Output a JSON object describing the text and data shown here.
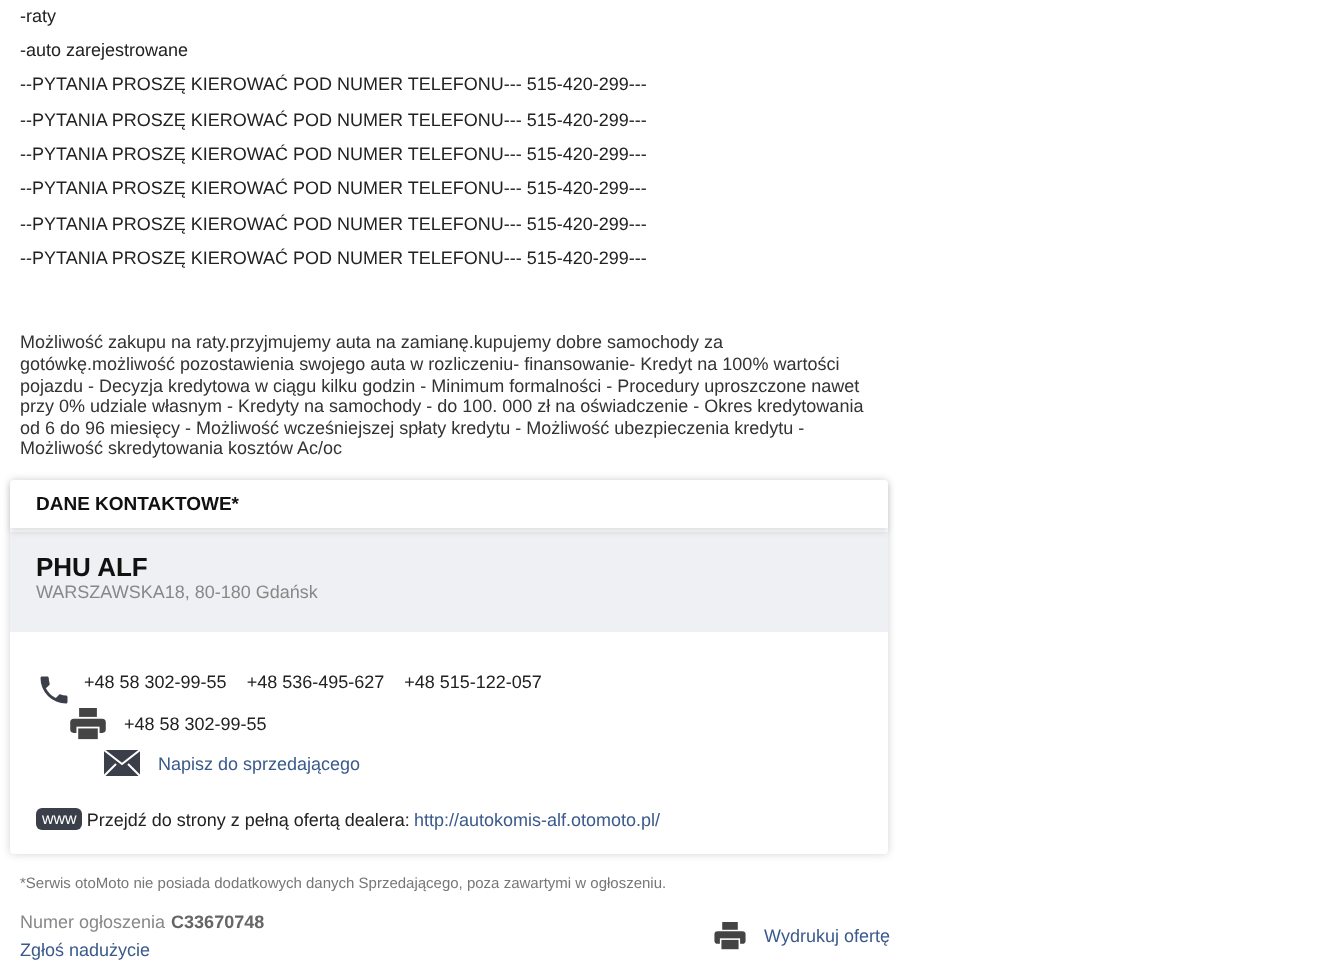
{
  "description_lines": [
    "-raty",
    "-auto zarejestrowane",
    "--PYTANIA PROSZĘ KIEROWAĆ POD NUMER TELEFONU--- 515-420-299---",
    "--PYTANIA PROSZĘ KIEROWAĆ POD NUMER TELEFONU--- 515-420-299---",
    "--PYTANIA PROSZĘ KIEROWAĆ POD NUMER TELEFONU--- 515-420-299---",
    "--PYTANIA PROSZĘ KIEROWAĆ POD NUMER TELEFONU--- 515-420-299---",
    "--PYTANIA PROSZĘ KIEROWAĆ POD NUMER TELEFONU--- 515-420-299---",
    "--PYTANIA PROSZĘ KIEROWAĆ POD NUMER TELEFONU--- 515-420-299---"
  ],
  "paragraph": "Możliwość zakupu na raty.przyjmujemy auta na zamianę.kupujemy dobre samochody za gotówkę.możliwość pozostawienia swojego auta w rozliczeniu- finansowanie- Kredyt na 100% wartości pojazdu - Decyzja kredytowa w ciągu kilku godzin - Minimum formalności - Procedury uproszczone nawet przy 0% udziale własnym - Kredyty na samochody - do 100. 000 zł na oświadczenie - Okres kredytowania od 6 do 96 miesięcy - Możliwość wcześniejszej spłaty kredytu - Możliwość ubezpieczenia kredytu - Możliwość skredytowania kosztów Ac/oc",
  "contact": {
    "title": "DANE KONTAKTOWE*",
    "company": "PHU ALF",
    "address": "WARSZAWSKA18, 80-180 Gdańsk",
    "phones": [
      "+48 58 302-99-55",
      "+48 536-495-627",
      "+48 515-122-057"
    ],
    "fax": "+48 58 302-99-55",
    "message_link": "Napisz do sprzedającego",
    "www_badge": "www",
    "website_label": "Przejdź do strony z pełną ofertą dealera:",
    "website_link": "http://autokomis-alf.otomoto.pl/"
  },
  "footnote": "*Serwis otoMoto nie posiada dodatkowych danych Sprzedającego, poza zawartymi w ogłoszeniu.",
  "ad_number_label": "Numer ogłoszenia",
  "ad_number": "C33670748",
  "report_link": "Zgłoś nadużycie",
  "print_link": "Wydrukuj ofertę"
}
